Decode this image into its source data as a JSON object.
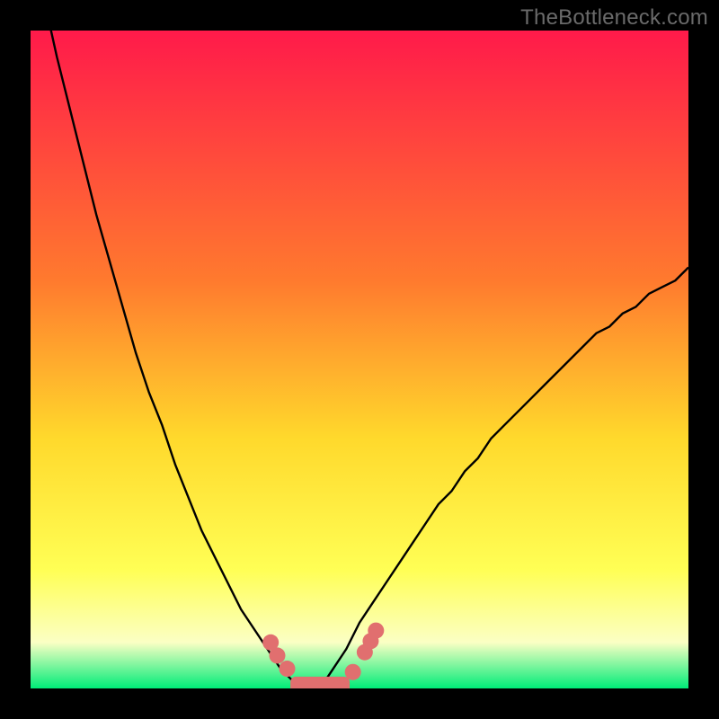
{
  "watermark": "TheBottleneck.com",
  "colors": {
    "gradient_top": "#ff1a4a",
    "gradient_mid1": "#ff7a2e",
    "gradient_mid2": "#ffd92c",
    "gradient_mid3": "#ffff55",
    "gradient_mid4": "#fbffc4",
    "gradient_bottom": "#00ec78",
    "curve": "#000000",
    "marker": "#e16f6f",
    "marker_stroke": "#e16f6f",
    "band": "#e16f6f"
  },
  "chart_data": {
    "type": "line",
    "title": "",
    "xlabel": "",
    "ylabel": "",
    "x": [
      0.0,
      0.02,
      0.04,
      0.06,
      0.08,
      0.1,
      0.12,
      0.14,
      0.16,
      0.18,
      0.2,
      0.22,
      0.24,
      0.26,
      0.28,
      0.3,
      0.32,
      0.34,
      0.36,
      0.38,
      0.4,
      0.42,
      0.44,
      0.46,
      0.48,
      0.5,
      0.52,
      0.54,
      0.56,
      0.58,
      0.6,
      0.62,
      0.64,
      0.66,
      0.68,
      0.7,
      0.72,
      0.74,
      0.76,
      0.78,
      0.8,
      0.82,
      0.84,
      0.86,
      0.88,
      0.9,
      0.92,
      0.94,
      0.96,
      0.98,
      1.0
    ],
    "y": [
      1.14,
      1.05,
      0.96,
      0.88,
      0.8,
      0.72,
      0.65,
      0.58,
      0.51,
      0.45,
      0.4,
      0.34,
      0.29,
      0.24,
      0.2,
      0.16,
      0.12,
      0.09,
      0.06,
      0.03,
      0.01,
      0.0,
      0.0,
      0.03,
      0.06,
      0.1,
      0.13,
      0.16,
      0.19,
      0.22,
      0.25,
      0.28,
      0.3,
      0.33,
      0.35,
      0.38,
      0.4,
      0.42,
      0.44,
      0.46,
      0.48,
      0.5,
      0.52,
      0.54,
      0.55,
      0.57,
      0.58,
      0.6,
      0.61,
      0.62,
      0.64
    ],
    "xlim": [
      0,
      1
    ],
    "ylim": [
      0,
      1
    ],
    "markers": {
      "x": [
        0.365,
        0.375,
        0.39,
        0.41,
        0.43,
        0.45,
        0.47,
        0.49,
        0.508,
        0.517,
        0.525
      ],
      "y": [
        0.07,
        0.05,
        0.03,
        0.0,
        0.0,
        0.0,
        0.0,
        0.025,
        0.055,
        0.072,
        0.088
      ]
    },
    "flatband": {
      "x0": 0.395,
      "x1": 0.485,
      "y": 0.0,
      "thickness": 0.018
    }
  }
}
